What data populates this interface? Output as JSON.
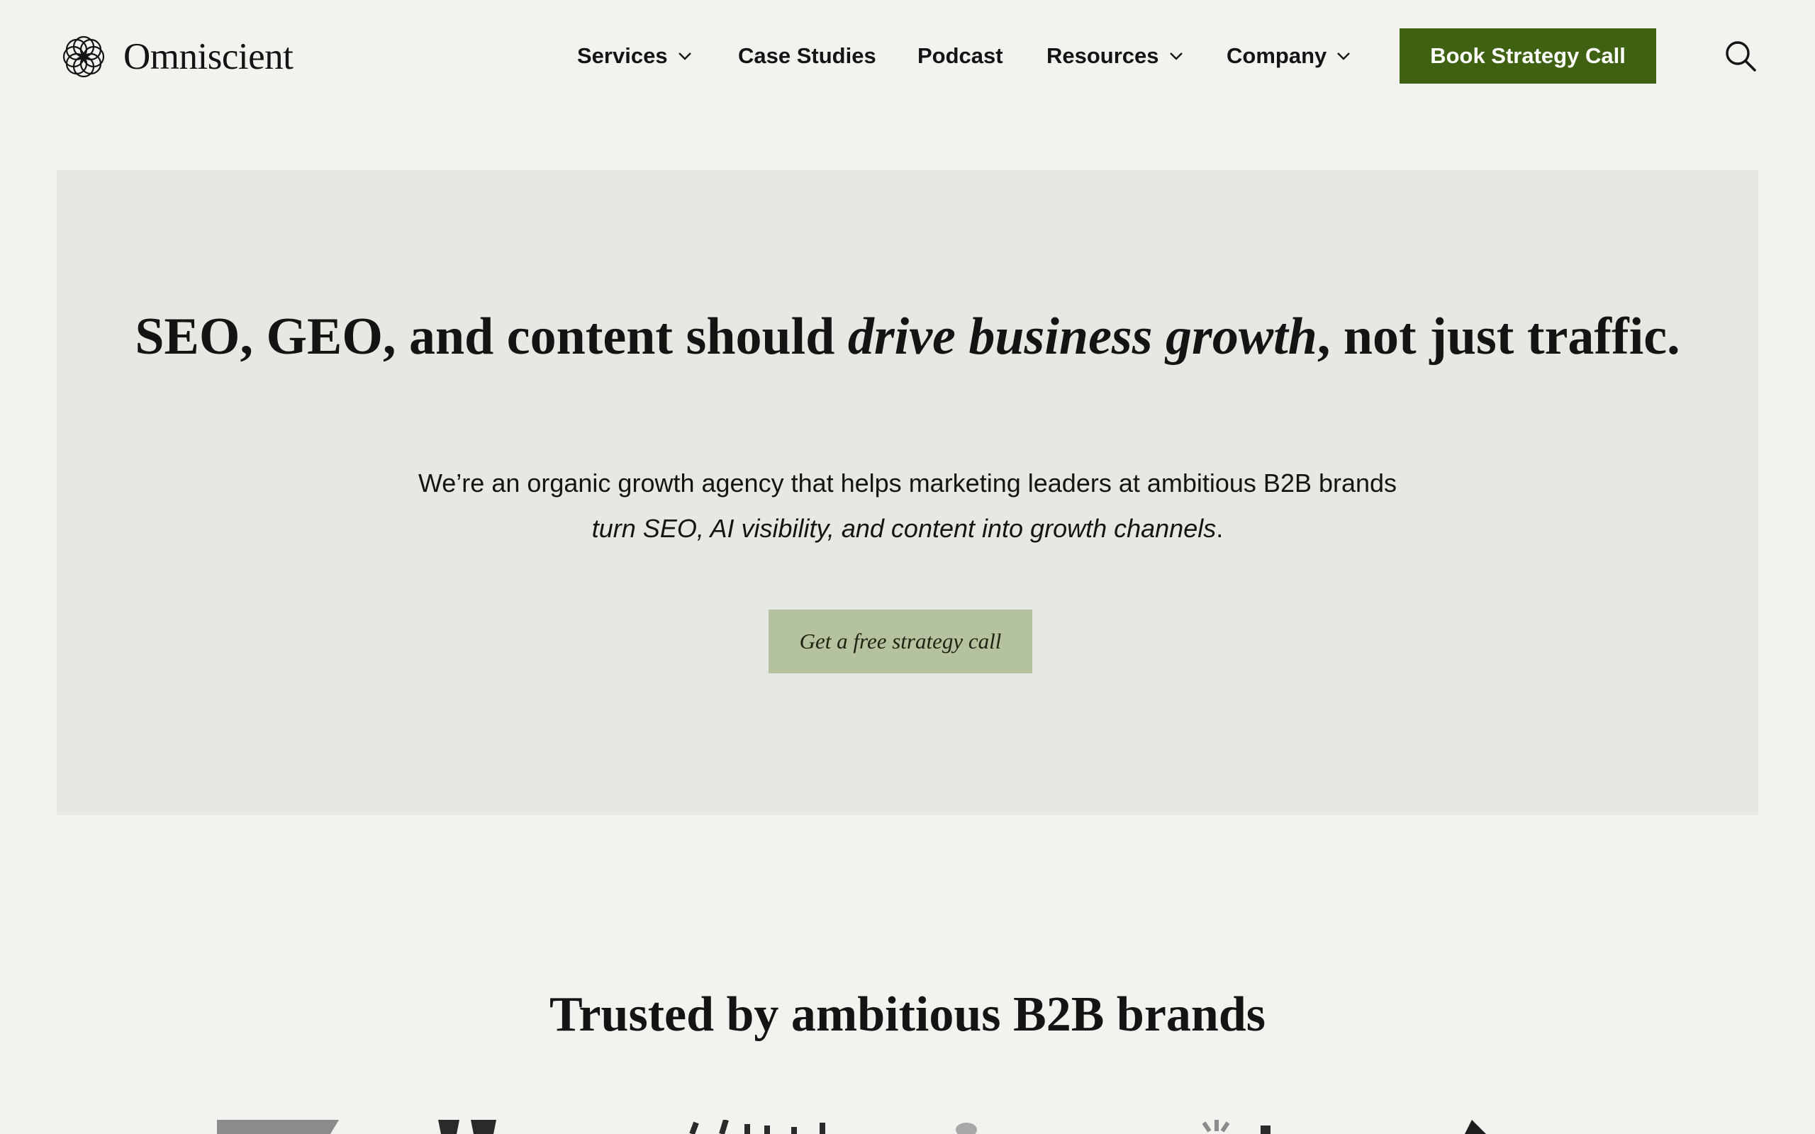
{
  "brand": {
    "name": "Omniscient",
    "logo_icon": "knot-rosette-icon"
  },
  "nav": {
    "items": [
      {
        "label": "Services",
        "has_dropdown": true
      },
      {
        "label": "Case Studies",
        "has_dropdown": false
      },
      {
        "label": "Podcast",
        "has_dropdown": false
      },
      {
        "label": "Resources",
        "has_dropdown": true
      },
      {
        "label": "Company",
        "has_dropdown": true
      }
    ],
    "cta_label": "Book Strategy Call",
    "search_icon": "search-icon"
  },
  "hero": {
    "title_part1": "SEO, GEO, and content should ",
    "title_em": "drive business growth",
    "title_part2": ", not just traffic.",
    "subtitle_part1": "We’re an organic growth agency that helps marketing leaders at ambitious B2B brands ",
    "subtitle_em": "turn SEO, AI visibility, and content into growth channels",
    "subtitle_part2": ".",
    "cta_label": "Get a free strategy call"
  },
  "trusted": {
    "heading": "Trusted by ambitious B2B brands"
  },
  "colors": {
    "page_bg": "#f2f3ee",
    "hero_bg": "#e6e9e1",
    "accent_green": "#3f6212",
    "soft_green": "#b5c2a0",
    "text": "#141414"
  }
}
